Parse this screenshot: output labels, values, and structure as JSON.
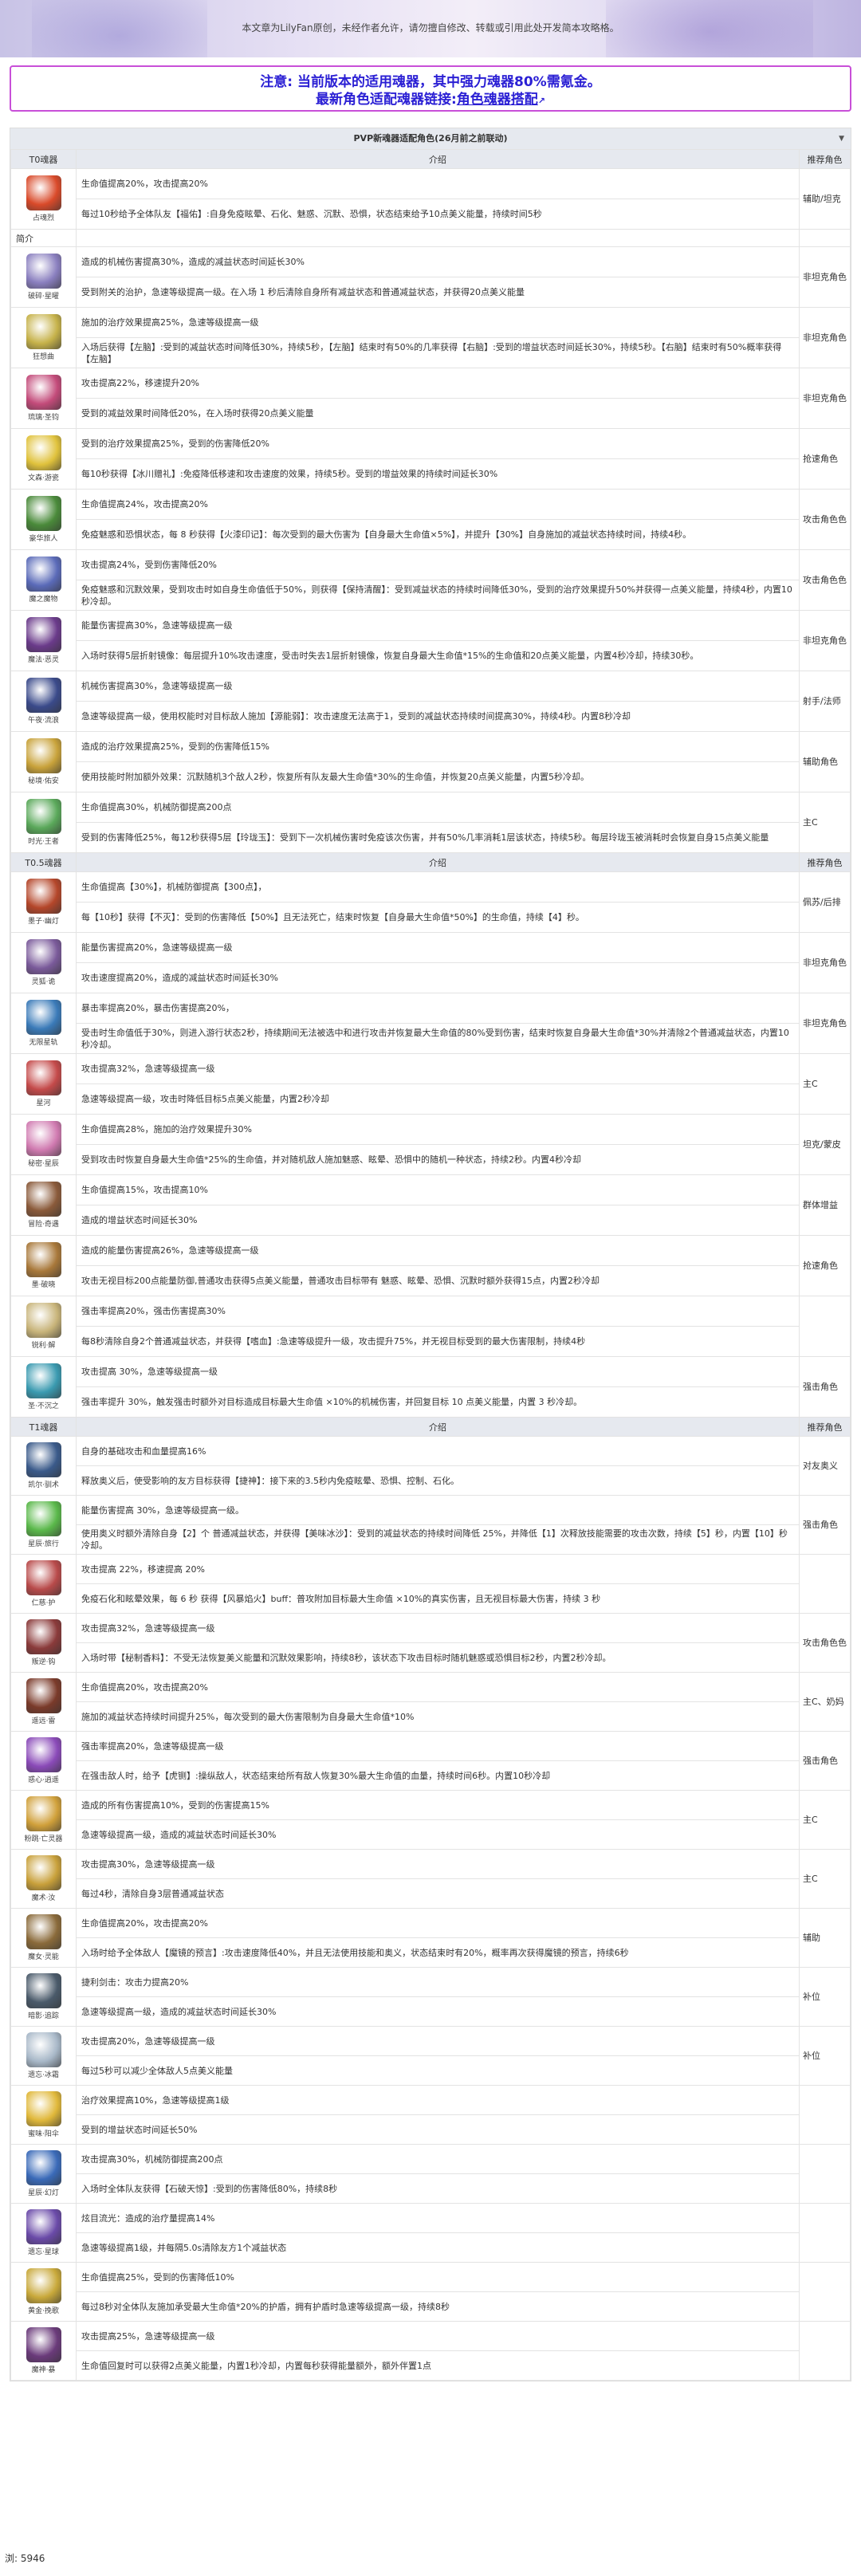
{
  "hero": {
    "note": "本文章为LilyFan原创，未经作者允许，请勿擅自修改、转载或引用此处开发简本攻略格。"
  },
  "notice": {
    "line1": "注意: 当前版本的适用魂器，其中强力魂器80%需氪金。",
    "line2_prefix": "最新角色适配魂器链接:",
    "line2_link": "角色魂器搭配"
  },
  "panel": {
    "title": "PVP新魂器适配角色(26月前之前联动)",
    "collapse_icon": "triangle-down-icon"
  },
  "headers": {
    "t0": "T0魂器",
    "t05": "T0.5魂器",
    "t1": "T1魂器",
    "effect": "介绍",
    "rec": "推荐角色"
  },
  "intro_label": "简介",
  "t0": [
    {
      "name": "占魂烈",
      "color": "#d94a2a",
      "effects": [
        "生命值提高20%，攻击提高20%",
        "每过10秒给予全体队友【福佑】:自身免疫眩晕、石化、魅惑、沉默、恐惧，状态结束给予10点美义能量，持续时间5秒"
      ],
      "rec": "辅助/坦克"
    },
    {
      "name": "破碎·星曜",
      "color": "#8a7fbf",
      "effects": [
        "造成的机械伤害提高30%，造成的减益状态时间延长30%",
        "受到附关的治护，急速等级提高一级。在入场 1 秒后清除自身所有减益状态和普通减益状态，并获得20点美义能量"
      ],
      "rec": "非坦克角色"
    },
    {
      "name": "狂想曲",
      "color": "#c6b24a",
      "effects": [
        "施加的治疗效果提高25%，急速等级提高一级",
        "入场后获得【左脑】:受到的减益状态时间降低30%，持续5秒，【左脑】结束时有50%的几率获得【右脑】:受到的增益状态时间延长30%，持续5秒。【右脑】结束时有50%概率获得【左脑】"
      ],
      "rec": "非坦克角色"
    },
    {
      "name": "琉璃·圣钧",
      "color": "#c34b7a",
      "effects": [
        "攻击提高22%，移速提升20%",
        "受到的减益效果时间降低20%，在入场时获得20点美义能量"
      ],
      "rec": "非坦克角色"
    },
    {
      "name": "文森·游瓷",
      "color": "#e0c23c",
      "effects": [
        "受到的治疗效果提高25%，受到的伤害降低20%",
        "每10秒获得【冰川赠礼】:免疫降低移速和攻击速度的效果，持续5秒。受到的增益效果的持续时间延长30%"
      ],
      "rec": "抢速角色"
    },
    {
      "name": "豪华旅人",
      "color": "#4a8a3a",
      "effects": [
        "生命值提高24%，攻击提高20%",
        "免疫魅惑和恐惧状态，每 8 秒获得【火漆印记】：每次受到的最大伤害为【自身最大生命值×5%】，并提升【30%】自身施加的减益状态持续时间，持续4秒。"
      ],
      "rec": "攻击角色色"
    },
    {
      "name": "魔之魔物",
      "color": "#5a6ab8",
      "effects": [
        "攻击提高24%，受到伤害降低20%",
        "免疫魅惑和沉默效果，受到攻击时如自身生命值低于50%，则获得【保持清醒】：受到减益状态的持续时间降低30%，受到的治疗效果提升50%并获得一点美义能量，持续4秒，内置10秒冷却。"
      ],
      "rec": "攻击角色色"
    },
    {
      "name": "魔法·恶灵",
      "color": "#6a3a8a",
      "effects": [
        "能量伤害提高30%，急速等级提高一级",
        "入场时获得5层折射镜像：每层提升10%攻击速度，受击时失去1层折射镜像，恢复自身最大生命值*15%的生命值和20点美义能量，内置4秒冷却，持续30秒。"
      ],
      "rec": "非坦克角色"
    },
    {
      "name": "午夜·流浪",
      "color": "#3a4a8a",
      "effects": [
        "机械伤害提高30%，急速等级提高一级",
        "急速等级提高一级，使用权能时对目标敌人施加【源能弱】：攻击速度无法高于1，受到的减益状态持续时间提高30%，持续4秒。内置8秒冷却"
      ],
      "rec": "射手/法师"
    },
    {
      "name": "秘境·佑安",
      "color": "#c8a23a",
      "effects": [
        "造成的治疗效果提高25%，受到的伤害降低15%",
        "使用技能时附加额外效果：沉默随机3个敌人2秒，恢复所有队友最大生命值*30%的生命值，并恢复20点美义能量，内置5秒冷却。"
      ],
      "rec": "辅助角色"
    },
    {
      "name": "时光·王者",
      "color": "#5aa85a",
      "effects": [
        "生命值提高30%，机械防御提高200点",
        "受到的伤害降低25%，每12秒获得5层【玲珑玉】：受到下一次机械伤害时免疫该次伤害，并有50%几率消耗1层该状态，持续5秒。每层玲珑玉被消耗时会恢复自身15点美义能量"
      ],
      "rec": "主C"
    }
  ],
  "t05": [
    {
      "name": "墨子·幽灯",
      "color": "#b4462a",
      "effects": [
        "生命值提高【30%】，机械防御提高【300点】，",
        "每【10秒】获得【不灭】：受到的伤害降低【50%】且无法死亡，结束时恢复【自身最大生命值*50%】的生命值，持续【4】秒。"
      ],
      "rec": "佩苏/后排"
    },
    {
      "name": "灵狐·诡",
      "color": "#7a5a9a",
      "effects": [
        "能量伤害提高20%，急速等级提高一级",
        "攻击速度提高20%，造成的减益状态时间延长30%"
      ],
      "rec": "非坦克角色"
    },
    {
      "name": "无限星轨",
      "color": "#3a7ab8",
      "effects": [
        "暴击率提高20%，暴击伤害提高20%，",
        "受击时生命值低于30%，则进入游行状态2秒，持续期间无法被选中和进行攻击并恢复最大生命值的80%受到伤害，结束时恢复自身最大生命值*30%并清除2个普通减益状态，内置10秒冷却。"
      ],
      "rec": "非坦克角色"
    },
    {
      "name": "星河",
      "color": "#c44a4a",
      "effects": [
        "攻击提高32%，急速等级提高一级",
        "急速等级提高一级，攻击时降低目标5点美义能量，内置2秒冷却"
      ],
      "rec": "主C"
    },
    {
      "name": "秘密·星辰",
      "color": "#d07ab0",
      "effects": [
        "生命值提高28%，施加的治疗效果提升30%",
        "受到攻击时恢复自身最大生命值*25%的生命值，并对随机敌人施加魅惑、眩晕、恐惧中的随机一种状态，持续2秒。内置4秒冷却"
      ],
      "rec": "坦克/蒙皮"
    },
    {
      "name": "冒险·奇遇",
      "color": "#8a5a3a",
      "effects": [
        "生命值提高15%，攻击提高10%",
        "造成的增益状态时间延长30%"
      ],
      "rec": "群体增益"
    },
    {
      "name": "墨·破晓",
      "color": "#a8783a",
      "effects": [
        "造成的能量伤害提高26%，急速等级提高一级",
        "攻击无视目标200点能量防御,普通攻击获得5点美义能量，普通攻击目标带有 魅惑、眩晕、恐惧、沉默时额外获得15点，内置2秒冷却"
      ],
      "rec": "抢速角色"
    },
    {
      "name": "锐利·解",
      "color": "#c8b47a",
      "effects": [
        "强击率提高20%，强击伤害提高30%",
        "每8秒清除自身2个普通减益状态，并获得【嗜血】:急速等级提升一级，攻击提升75%，并无视目标受到的最大伤害限制，持续4秒"
      ],
      "rec": ""
    },
    {
      "name": "圣·不沉之",
      "color": "#3a9ab0",
      "effects": [
        "攻击提高 30%，急速等级提高一级",
        "强击率提升 30%，触发强击时额外对目标造成目标最大生命值 ×10%的机械伤害，并回复目标 10 点美义能量，内置 3 秒冷却。"
      ],
      "rec": "强击角色"
    }
  ],
  "t1": [
    {
      "name": "凯尔·驯术",
      "color": "#3a5a8a",
      "effects": [
        "自身的基础攻击和血量提高16%",
        "释放奥义后，使受影响的友方目标获得【捷神】：接下来的3.5秒内免疫眩晕、恐惧、控制、石化。"
      ],
      "rec": "对友奥义"
    },
    {
      "name": "星辰·旅行",
      "color": "#5ab84a",
      "effects": [
        "能量伤害提高 30%，急速等级提高一级。",
        "使用奥义时额外清除自身【2】个 普通减益状态，并获得【美味冰沙】：受到的减益状态的持续时间降低 25%，并降低【1】次释放技能需要的攻击次数，持续【5】秒，内置【10】秒冷却。"
      ],
      "rec": "强击角色"
    },
    {
      "name": "仁慈·护",
      "color": "#b84a4a",
      "effects": [
        "攻击提高 22%，移速提高 20%",
        "免疫石化和眩晕效果，每 6 秒 获得【风暴焰火】buff：普攻附加目标最大生命值 ×10%的真实伤害，且无视目标最大伤害，持续 3 秒"
      ],
      "rec": ""
    },
    {
      "name": "叛逆·钩",
      "color": "#8a3a3a",
      "effects": [
        "攻击提高32%，急速等级提高一级",
        "入场时带【秘制香料】：不受无法恢复美义能量和沉默效果影响，持续8秒，该状态下攻击目标时随机魅惑或恐惧目标2秒，内置2秒冷却。"
      ],
      "rec": "攻击角色色"
    },
    {
      "name": "遥远·雷",
      "color": "#7a3a2a",
      "effects": [
        "生命值提高20%，攻击提高20%",
        "施加的减益状态持续时间提升25%，每次受到的最大伤害限制为自身最大生命值*10%"
      ],
      "rec": "主C、奶妈"
    },
    {
      "name": "惑心·逍遥",
      "color": "#8a4ab8",
      "effects": [
        "强击率提高20%，急速等级提高一级",
        "在强击敌人时，给予【虎铡】:操纵敌人，状态结束给所有敌人恢复30%最大生命值的血量，持续时间6秒。内置10秒冷却"
      ],
      "rec": "强击角色"
    },
    {
      "name": "粉跳·亡灵器",
      "color": "#d0a03a",
      "effects": [
        "造成的所有伤害提高10%，受到的伤害提高15%",
        "急速等级提高一级，造成的减益状态时间延长30%"
      ],
      "rec": "主C"
    },
    {
      "name": "魔术·汝",
      "color": "#c8a03a",
      "effects": [
        "攻击提高30%，急速等级提高一级",
        "每过4秒，清除自身3层普通减益状态"
      ],
      "rec": "主C"
    },
    {
      "name": "魔女·灵能",
      "color": "#8a6a3a",
      "effects": [
        "生命值提高20%，攻击提高20%",
        "入场时给予全体敌人【魔镜的预言】:攻击速度降低40%，并且无法使用技能和奥义，状态结束时有20%，概率再次获得魔镜的预言，持续6秒"
      ],
      "rec": "辅助"
    },
    {
      "name": "暗影·追踪",
      "color": "#4a5a6a",
      "effects": [
        "捷利剑击：攻击力提高20%",
        "急速等级提高一级，造成的减益状态时间延长30%"
      ],
      "rec": "补位"
    },
    {
      "name": "遗忘·冰霜",
      "color": "#a8b8c8",
      "effects": [
        "攻击提高20%，急速等级提高一级",
        "每过5秒可以减少全体敌人5点美义能量"
      ],
      "rec": "补位"
    },
    {
      "name": "蜜味·阳伞",
      "color": "#e0b83a",
      "effects": [
        "治疗效果提高10%，急速等级提高1级",
        "受到的增益状态时间延长50%"
      ],
      "rec": ""
    },
    {
      "name": "星辰·幻灯",
      "color": "#3a6ab8",
      "effects": [
        "攻击提高30%，机械防御提高200点",
        "入场时全体队友获得【石破天惊】:受到的伤害降低80%，持续8秒"
      ],
      "rec": ""
    },
    {
      "name": "遗忘·星球",
      "color": "#6a4aa8",
      "effects": [
        "炫目流光：造成的治疗量提高14%",
        "急速等级提高1级，并每隔5.0s清除友方1个减益状态"
      ],
      "rec": ""
    },
    {
      "name": "黄金·挽歌",
      "color": "#c8a83a",
      "effects": [
        "生命值提高25%，受到的伤害降低10%",
        "每过8秒对全体队友施加承受最大生命值*20%的护盾，拥有护盾时急速等级提高一级，持续8秒"
      ],
      "rec": ""
    },
    {
      "name": "魔神·暴",
      "color": "#6a3a7a",
      "effects": [
        "攻击提高25%，急速等级提高一级",
        "生命值回复时可以获得2点美义能量，内置1秒冷却，内置每秒获得能量额外，额外伴置1点"
      ],
      "rec": ""
    }
  ],
  "footer": {
    "count": "浏: 5946"
  }
}
